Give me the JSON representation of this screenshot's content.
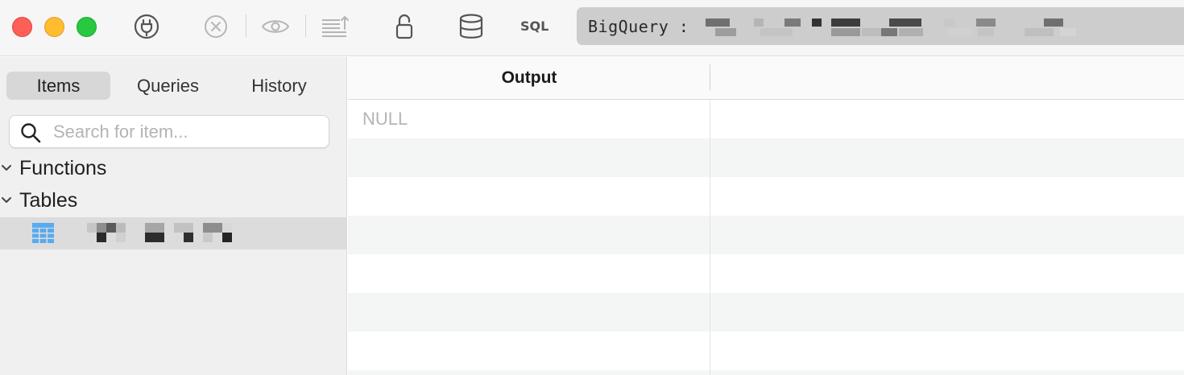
{
  "window": {
    "traffic_lights": [
      "close",
      "minimize",
      "zoom"
    ]
  },
  "toolbar": {
    "icons": [
      "plug-icon",
      "stop-icon",
      "eye-icon",
      "align-icon",
      "unlock-icon",
      "database-icon"
    ],
    "sql_label": "SQL",
    "connection_prefix": "BigQuery :"
  },
  "sidebar": {
    "tabs": [
      {
        "label": "Items",
        "active": true
      },
      {
        "label": "Queries",
        "active": false
      },
      {
        "label": "History",
        "active": false
      }
    ],
    "search_placeholder": "Search for item...",
    "tree": [
      {
        "label": "Functions",
        "expanded": true
      },
      {
        "label": "Tables",
        "expanded": true
      }
    ],
    "selected_table_icon": "table-icon"
  },
  "results": {
    "columns": [
      "Output"
    ],
    "rows": [
      [
        "NULL"
      ]
    ]
  },
  "colors": {
    "accent_table_icon": "#5aaaf0",
    "close": "#fe5f57",
    "minimize": "#febc2e",
    "zoom": "#28c840"
  }
}
